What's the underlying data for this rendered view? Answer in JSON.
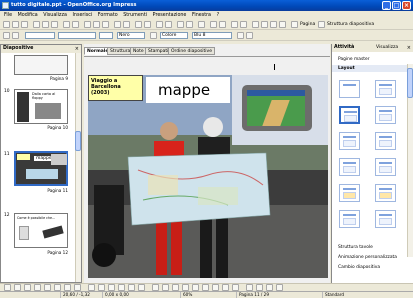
{
  "window": {
    "title": "tutto digitale.ppt - OpenOffice.org Impress"
  },
  "menu": [
    "File",
    "Modifica",
    "Visualizza",
    "Inserisci",
    "Formato",
    "Strumenti",
    "Presentazione",
    "Finestra",
    "?"
  ],
  "toolbar": {
    "pagina_label": "Pagina",
    "struttura_label": "Struttura diapositiva",
    "color_value": "Nero",
    "colore_value": "Colore",
    "blu_value": "Blu 8"
  },
  "slides_panel": {
    "title": "Diapositive",
    "slides": [
      {
        "num": "",
        "label": "Pagina 9"
      },
      {
        "num": "10",
        "label": "Pagina 10",
        "caption": "Dalla carta al floppy"
      },
      {
        "num": "11",
        "label": "Pagina 11",
        "caption": "mappe"
      },
      {
        "num": "12",
        "label": "Pagina 12",
        "caption": "Come è possibile che..."
      }
    ]
  },
  "view_tabs": [
    "Normale",
    "Struttura",
    "Note",
    "Stampati",
    "Ordine diapositive"
  ],
  "slide": {
    "caption": "Viaggio a Barcellona (2003)",
    "title": "mappe"
  },
  "tasks_panel": {
    "title": "Attività",
    "view_label": "Visualizza",
    "sections": {
      "master": "Pagine master",
      "layout": "Layout",
      "table": "Struttura tavole",
      "animation": "Animazione personalizzata",
      "transition": "Cambio diapositiva"
    }
  },
  "status": {
    "position": "20,60 / -1,32",
    "size": "0,00 x 0,00",
    "zoom": "60%",
    "page": "Pagina 11 / 29",
    "style": "Standard"
  }
}
